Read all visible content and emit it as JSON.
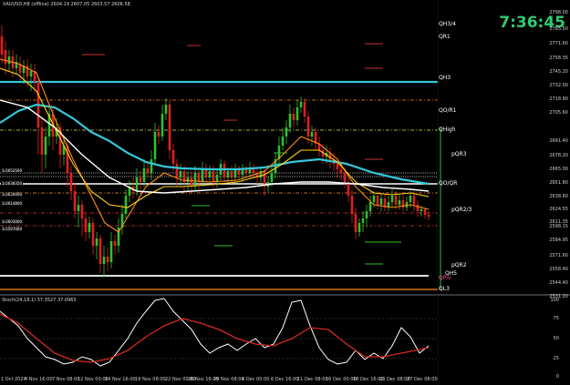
{
  "header": {
    "text": "XAUUSD,H8 (offline) 2604.19 2607.05 2603.57 2606.58"
  },
  "clock": {
    "time": "7:36:45"
  },
  "price_axis": {
    "labels": [
      "2798.00",
      "2785.50",
      "2771.60",
      "2758.35",
      "2745.20",
      "2732.00",
      "2718.80",
      "2705.60",
      "2691.40",
      "2678.20",
      "2665.00",
      "2651.80",
      "2638.60",
      "2624.55",
      "2611.35",
      "2598.15",
      "2584.95",
      "2571.60",
      "2558.40",
      "2544.40",
      "2531.20"
    ]
  },
  "stoch_axis": {
    "labels": [
      "100",
      "75",
      "50",
      "25",
      "0"
    ]
  },
  "stoch": {
    "header": "Stoch(24,18,1) 37.3527 37.0965"
  },
  "time_axis": {
    "labels": [
      "1 Oct 2024",
      "4 Nov 16:00",
      "7 Nov 08:00",
      "12 Nov 00:00",
      "14 Nov 16:00",
      "19 Nov 08:00",
      "22 Nov 00:00",
      "26 Nov 16:00",
      "29 Nov 08:00",
      "4 Dec 00:00",
      "6 Dec 16:00",
      "11 Dec 08:00",
      "16 Dec 00:00",
      "18 Dec 16:00",
      "23 Dec 08:00",
      "27 Dec 08:00"
    ]
  },
  "levels": {
    "qh3_4": "QH3/4",
    "qr1": "QR1",
    "qh3": "QH3",
    "qoqr1": "QO/R1",
    "qhigh": "QHigh",
    "pqr3": "pQR3",
    "qoqr": "QO/QR",
    "pqr2_3": "pQR2/3",
    "pqr2": "pQR2",
    "qh5": "QH5",
    "piv": "QPiv",
    "ql3": "QL3"
  },
  "left_labels": [
    "1r2652500",
    "1r2638350",
    "1r2630000",
    "1r2614800",
    "1r2603000",
    "1r2597000"
  ],
  "colors": {
    "bull": "#2ec12e",
    "bear": "#e02020",
    "cyan": "#35c7d8",
    "orange": "#ff8c1a",
    "yellow": "#ffd21a",
    "white": "#ffffff",
    "stoch_main": "#ffffff",
    "stoch_signal": "#d42a1f"
  }
}
